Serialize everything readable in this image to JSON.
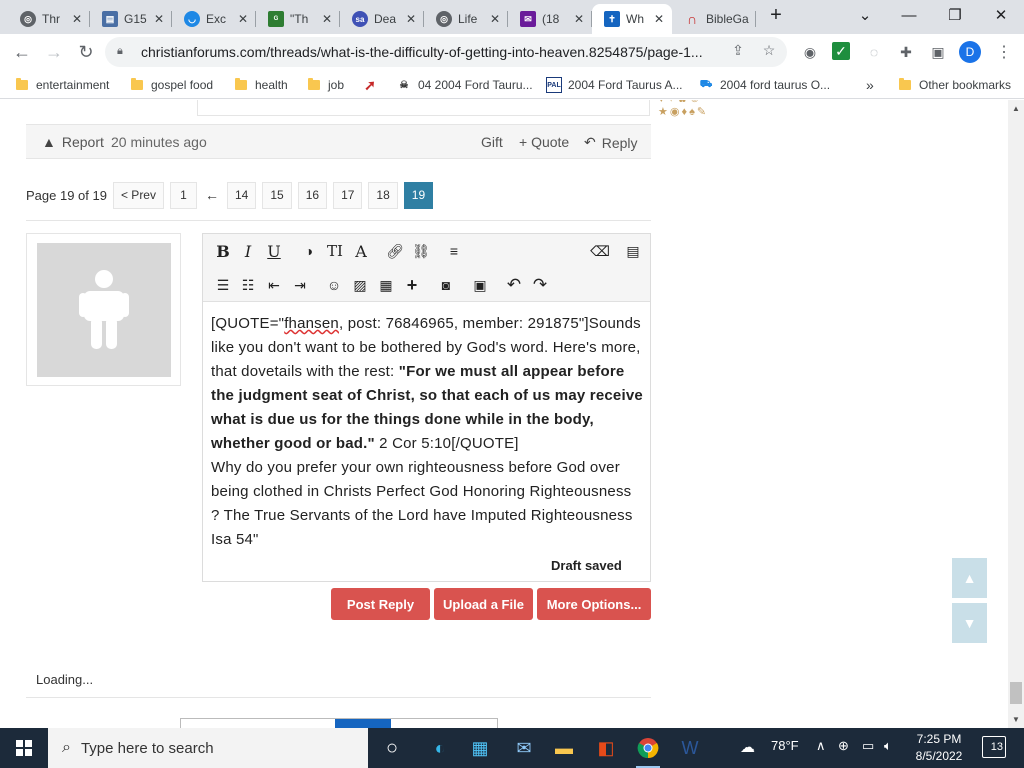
{
  "browser": {
    "tabs": [
      {
        "label": "Thr",
        "icon": "globe-icon",
        "color": "#5f6368"
      },
      {
        "label": "G15",
        "icon": "bible-icon",
        "color": "#4a6fa5"
      },
      {
        "label": "Exc",
        "icon": "exc-icon",
        "color": "#1e88e5"
      },
      {
        "label": "\"Th",
        "icon": "gospel-icon",
        "color": "#2e7d32"
      },
      {
        "label": "Dea",
        "icon": "sa-icon",
        "color": "#3f51b5"
      },
      {
        "label": "Life",
        "icon": "globe-icon",
        "color": "#5f6368"
      },
      {
        "label": "(18",
        "icon": "mail-icon",
        "color": "#6a1b9a"
      },
      {
        "label": "Wh",
        "icon": "forum-icon",
        "color": "#1565c0"
      },
      {
        "label": "BibleGa",
        "icon": "biblegateway-icon",
        "color": "#c62828"
      }
    ],
    "active_tab_index": 7,
    "new_tab_glyph": "+",
    "url": "christianforums.com/threads/what-is-the-difficulty-of-getting-into-heaven.8254875/page-1...",
    "profile_initial": "D",
    "bookmarks": [
      {
        "label": "entertainment",
        "type": "folder"
      },
      {
        "label": "gospel food",
        "type": "folder"
      },
      {
        "label": "health",
        "type": "folder"
      },
      {
        "label": "job",
        "type": "folder"
      },
      {
        "label": "",
        "type": "link",
        "icon": "red-swoosh-icon"
      },
      {
        "label": "04 2004 Ford Tauru...",
        "type": "link",
        "icon": "skull-icon"
      },
      {
        "label": "2004 Ford Taurus A...",
        "type": "link",
        "icon": "pal-icon",
        "badge": "PAL"
      },
      {
        "label": "2004 ford taurus O...",
        "type": "link",
        "icon": "car-icon"
      }
    ],
    "bookmarks_overflow": "»",
    "other_bookmarks": "Other bookmarks"
  },
  "post_footer": {
    "report": "Report",
    "time": "20 minutes ago",
    "gift": "Gift",
    "quote": "+ Quote",
    "reply": "Reply"
  },
  "pagination": {
    "label": "Page 19 of 19",
    "prev": "< Prev",
    "pages": [
      "1",
      "←",
      "14",
      "15",
      "16",
      "17",
      "18",
      "19"
    ],
    "current": "19"
  },
  "editor": {
    "content": {
      "p1": "[QUOTE=\"",
      "p1_wavy": "fhansen",
      "p1_rest": ", post: 76846965, member: 291875\"]Sounds like you don't want to be bothered by God's word. Here's more, that dovetails with the rest: ",
      "bold": "\"For we must all appear before the judgment seat of Christ, so that each of us may receive what is due us for the things done while in the body, whether good or bad.\"",
      "p2": " 2 Cor 5:10[/QUOTE]",
      "p3": "Why do you prefer your own righteousness before God over being clothed in Christs Perfect God Honoring Righteousness ? The True Servants of the Lord have Imputed Righteousness Isa 54\""
    },
    "draft_status": "Draft saved",
    "toolbar_glyphs": {
      "bold": "B",
      "italic": "I",
      "underline": "U",
      "text_size": "TI",
      "font": "A"
    }
  },
  "actions": {
    "post_reply": "Post Reply",
    "upload": "Upload a File",
    "more": "More Options..."
  },
  "loading": "Loading...",
  "taskbar": {
    "search_placeholder": "Type here to search",
    "weather": "78°F",
    "time": "7:25 PM",
    "date": "8/5/2022",
    "notifications": "13"
  },
  "colors": {
    "accent_blue": "#2f7fa3",
    "button_red": "#d9534f",
    "tab_bg": "#dee1e6"
  }
}
